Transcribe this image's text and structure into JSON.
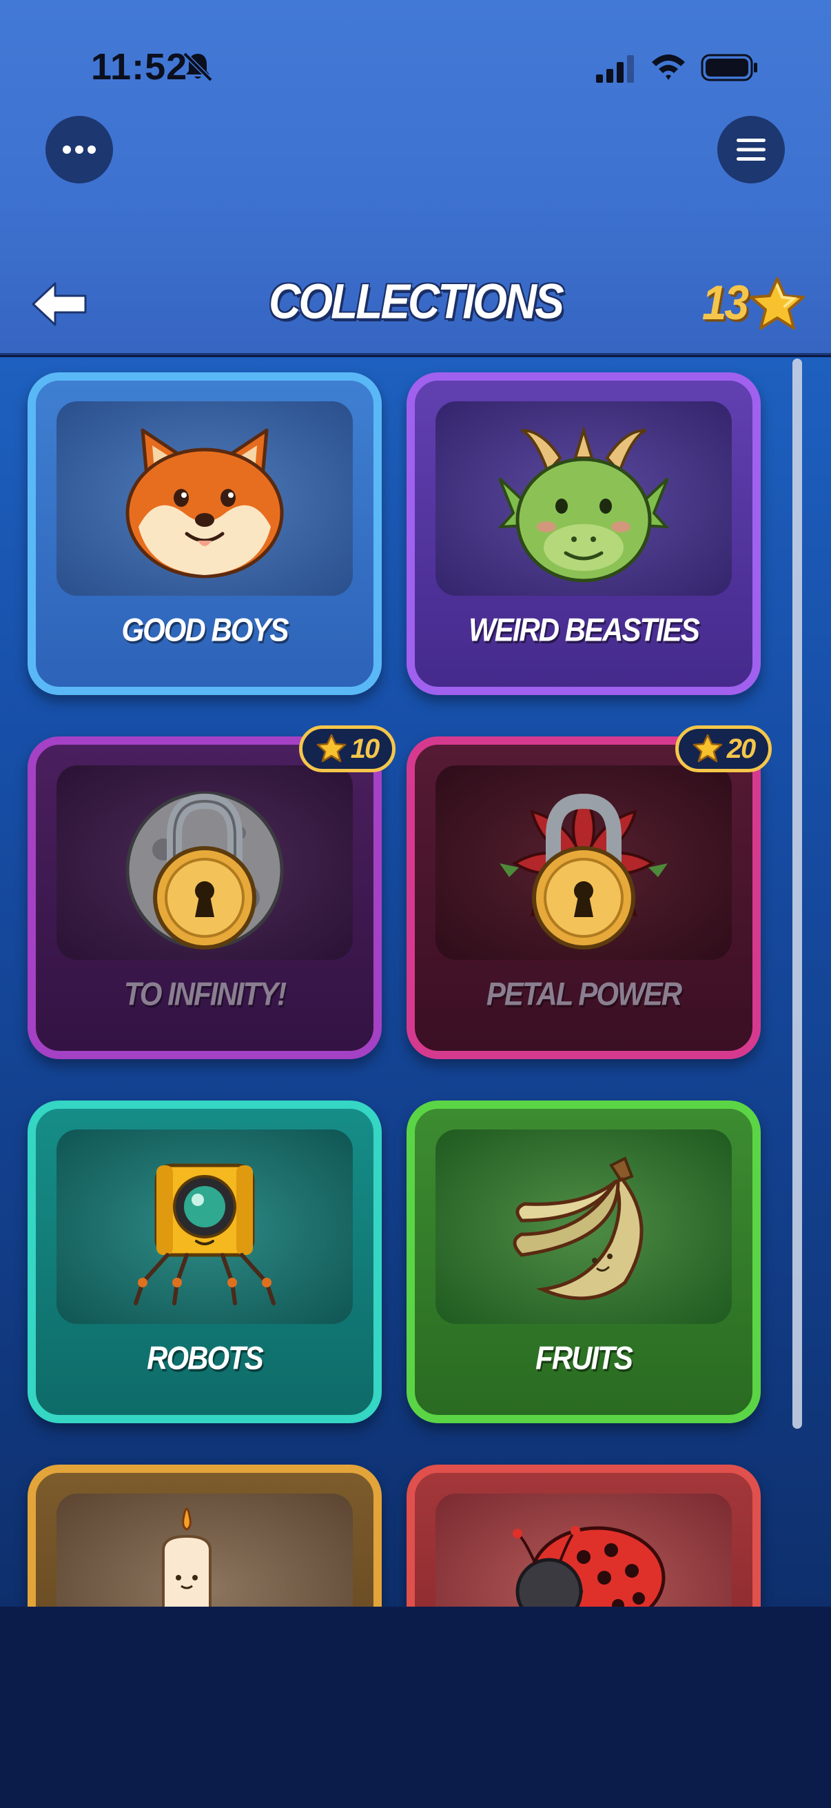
{
  "status_bar": {
    "time": "11:52",
    "icons": [
      "bell-slash-icon",
      "signal-icon",
      "wifi-icon",
      "battery-icon"
    ]
  },
  "toolbar": {
    "more_icon": "ellipsis-icon",
    "menu_icon": "hamburger-menu-icon"
  },
  "header": {
    "back_icon": "arrow-left-icon",
    "title": "COLLECTIONS",
    "star_count": "13",
    "star_icon": "star-icon"
  },
  "collections": [
    {
      "label": "GOOD BOYS",
      "art": "shiba-dog-icon",
      "locked": false,
      "border": "#5ab8f7"
    },
    {
      "label": "WEIRD BEASTIES",
      "art": "dragon-icon",
      "locked": false,
      "border": "#a061ee"
    },
    {
      "label": "TO INFINITY!",
      "art": "moon-lock-icon",
      "locked": true,
      "cost": "10",
      "border": "#a541c4"
    },
    {
      "label": "PETAL POWER",
      "art": "flower-lock-icon",
      "locked": true,
      "cost": "20",
      "border": "#d63a8e"
    },
    {
      "label": "ROBOTS",
      "art": "robot-icon",
      "locked": false,
      "border": "#35d6c3"
    },
    {
      "label": "FRUITS",
      "art": "banana-icon",
      "locked": false,
      "border": "#5bd545"
    },
    {
      "label": "",
      "art": "candle-icon",
      "locked": false,
      "border": "#e3a43a"
    },
    {
      "label": "",
      "art": "ladybug-icon",
      "locked": false,
      "border": "#e0504d"
    }
  ],
  "colors": {
    "accent_gold": "#f5c64b",
    "header_blue": "#4379d6",
    "background_navy": "#0c1c4a"
  }
}
